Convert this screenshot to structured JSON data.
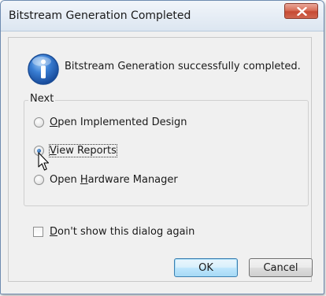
{
  "window": {
    "title": "Bitstream Generation Completed"
  },
  "message": "Bitstream Generation successfully completed.",
  "next_group": {
    "label": "Next",
    "options": [
      {
        "prefix": "",
        "mnemonic": "O",
        "rest": "pen Implemented Design",
        "checked": false
      },
      {
        "prefix": "",
        "mnemonic": "V",
        "rest": "iew Reports",
        "checked": true
      },
      {
        "prefix": "Open ",
        "mnemonic": "H",
        "rest": "ardware Manager",
        "checked": false
      }
    ]
  },
  "dont_show": {
    "mnemonic": "D",
    "rest": "on't show this dialog again",
    "checked": false
  },
  "buttons": {
    "ok": "OK",
    "cancel": "Cancel"
  },
  "colors": {
    "close_button": "#c64a33",
    "info_icon": "#2b6cc4"
  }
}
